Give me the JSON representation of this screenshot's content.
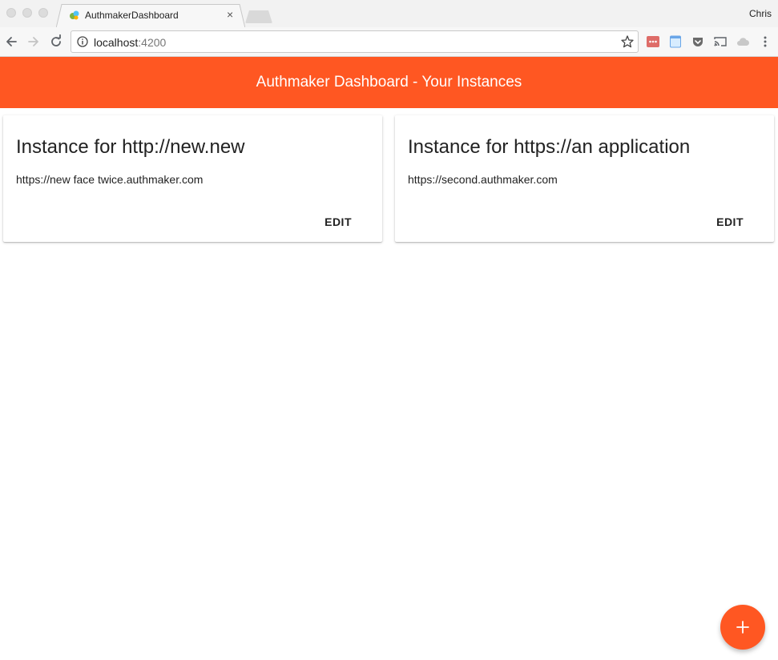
{
  "browser": {
    "tab_title": "AuthmakerDashboard",
    "tab_close": "×",
    "profile_name": "Chris",
    "url_host": "localhost",
    "url_port": ":4200"
  },
  "app": {
    "title": "Authmaker Dashboard - Your Instances",
    "accent_color": "#ff5722"
  },
  "instances": [
    {
      "title": "Instance for http://new.new",
      "subtitle": "https://new face twice.authmaker.com",
      "action_label": "EDIT"
    },
    {
      "title": "Instance for https://an application",
      "subtitle": "https://second.authmaker.com",
      "action_label": "EDIT"
    }
  ],
  "fab": {
    "icon": "plus-icon"
  }
}
